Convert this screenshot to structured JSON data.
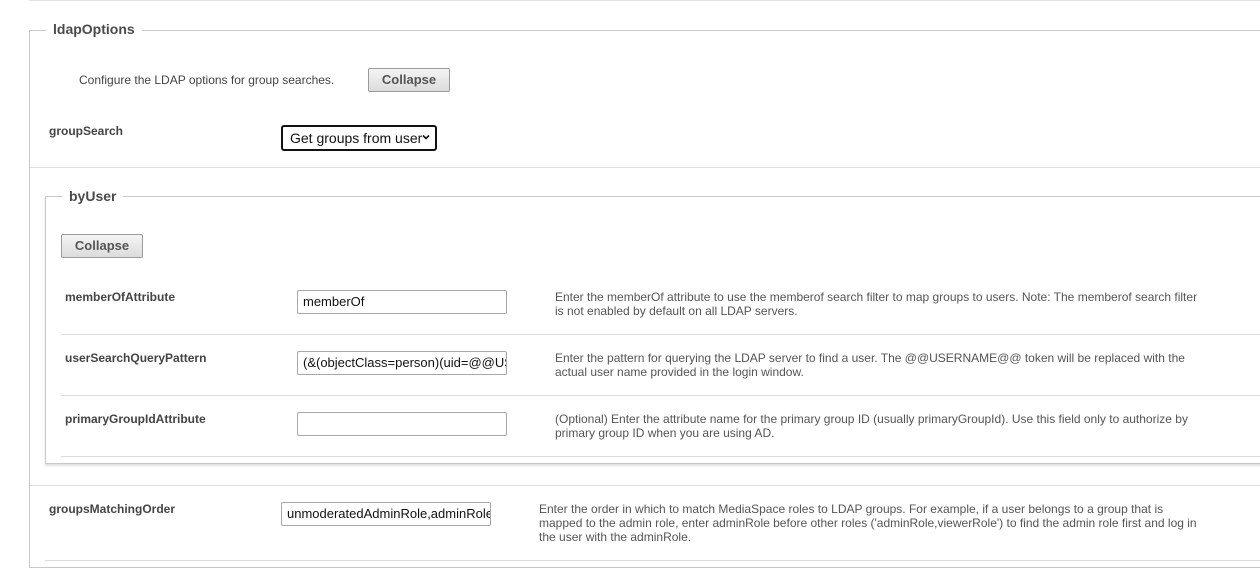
{
  "ldap_options": {
    "legend": "ldapOptions",
    "description": "Configure the LDAP options for group searches.",
    "collapse_label": "Collapse",
    "group_search": {
      "label": "groupSearch",
      "selected": "Get groups from user"
    }
  },
  "by_user": {
    "legend": "byUser",
    "collapse_label": "Collapse",
    "fields": [
      {
        "label": "memberOfAttribute",
        "value": "memberOf",
        "help": "Enter the memberOf attribute to use the memberof search filter to map groups to users. Note: The memberof search filter is not enabled by default on all LDAP servers.",
        "help_lines": [
          "Enter the memberOf attribute to use the memberof search filter to map groups to users. Note: The memberof search filter",
          "is not enabled by default on all LDAP servers."
        ]
      },
      {
        "label": "userSearchQueryPattern",
        "value": "(&(objectClass=person)(uid=@@USERNAME@@))",
        "help_lines": [
          "Enter the pattern for querying the LDAP server to find a user. The @@USERNAME@@ token will be replaced with the",
          "actual user name provided in the login window."
        ]
      },
      {
        "label": "primaryGroupIdAttribute",
        "value": "",
        "help_lines": [
          "(Optional) Enter the attribute name for the primary group ID (usually primaryGroupId). Use this field only to authorize by",
          "primary group ID when you are using AD."
        ]
      }
    ]
  },
  "groups_matching_order": {
    "label": "groupsMatchingOrder",
    "value": "unmoderatedAdminRole,adminRole,viewerRole",
    "help_lines": [
      "Enter the order in which to match MediaSpace roles to LDAP groups. For example, if a user belongs to a group that is",
      "mapped to the admin role, enter adminRole before other roles ('adminRole,viewerRole') to find the admin role first and log in",
      "the user with the adminRole."
    ]
  }
}
